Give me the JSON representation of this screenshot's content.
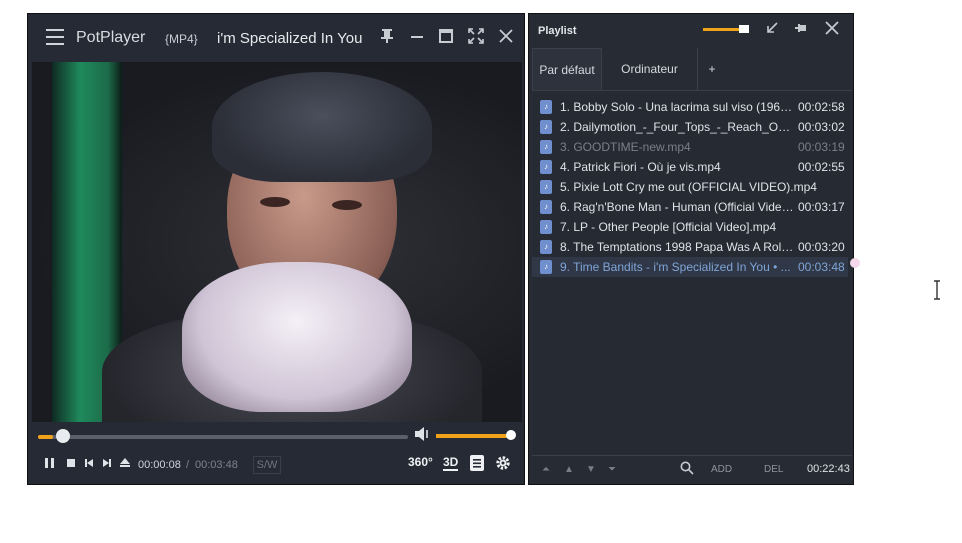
{
  "player": {
    "app_name": "PotPlayer",
    "format_badge": "{MP4}",
    "title": "i'm Specialized In You",
    "progress_fraction": 0.04,
    "volume_fraction": 1.0,
    "time_current": "00:00:08",
    "time_separator": "/",
    "time_total": "00:03:48",
    "sw_label": "S/W",
    "btn_360": "360°",
    "btn_3d": "3D"
  },
  "playlist": {
    "title": "Playlist",
    "tabs": [
      "Par défaut",
      "Ordinateur",
      "+"
    ],
    "items": [
      {
        "name": "1. Bobby Solo - Una lacrima sul viso (1964).mp4",
        "duration": "00:02:58",
        "state": "normal"
      },
      {
        "name": "2. Dailymotion_-_Four_Tops_-_Reach_Out_I'll_Be_There.mp4",
        "duration": "00:03:02",
        "state": "normal"
      },
      {
        "name": "3. GOODTIME-new.mp4",
        "duration": "00:03:19",
        "state": "dim"
      },
      {
        "name": "4. Patrick Fiori - Où je vis.mp4",
        "duration": "00:02:55",
        "state": "normal"
      },
      {
        "name": "5. Pixie Lott Cry me out (OFFICIAL VIDEO).mp4",
        "duration": "",
        "state": "normal"
      },
      {
        "name": "6. Rag'n'Bone Man - Human (Official Video).mp4",
        "duration": "00:03:17",
        "state": "normal"
      },
      {
        "name": "7. LP - Other People [Official Video].mp4",
        "duration": "",
        "state": "normal"
      },
      {
        "name": "8. The Temptations 1998 Papa Was A Rolling Stone.mp4",
        "duration": "00:03:20",
        "state": "normal"
      },
      {
        "name": "9. Time Bandits - i'm Specialized In You • ...",
        "duration": "00:03:48",
        "state": "selected"
      }
    ],
    "add_label": "ADD",
    "del_label": "DEL",
    "total_time": "00:22:43"
  },
  "icons": {
    "menu": "hamburger-icon",
    "pin": "pin-icon",
    "minimize": "minimize-icon",
    "maximize": "maximize-icon",
    "fullscreen": "fullscreen-icon",
    "close": "close-icon",
    "file": "file-icon",
    "search": "search-icon"
  },
  "colors": {
    "accent": "#f0a21a",
    "selected_text": "#7fa5d8",
    "window_bg": "#262a34"
  }
}
